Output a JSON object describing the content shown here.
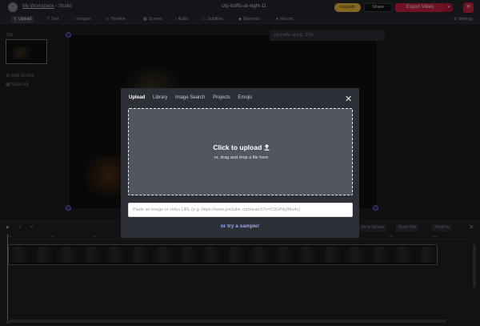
{
  "header": {
    "workspace_link": "My Workspace",
    "separator": "›",
    "current_page": "Studio",
    "project_title": "city-traffic-at-night-11",
    "upgrade_label": "Upgrade",
    "share_label": "Share",
    "export_label": "Export Video",
    "user_initial": "H"
  },
  "toolbar": {
    "items": [
      {
        "label": "Upload",
        "icon": "upload-icon",
        "glyph": "⇪",
        "active": true
      },
      {
        "label": "Text",
        "icon": "text-icon",
        "glyph": "T",
        "active": false
      },
      {
        "label": "Images",
        "icon": "images-icon",
        "glyph": "⌕",
        "active": false
      },
      {
        "label": "Timeline",
        "icon": "timeline-icon",
        "glyph": "≡",
        "active": false
      },
      {
        "label": "Scenes",
        "icon": "scenes-icon",
        "glyph": "▦",
        "active": false
      },
      {
        "label": "Audio",
        "icon": "audio-icon",
        "glyph": "♪",
        "active": false
      },
      {
        "label": "Subtitles",
        "icon": "subtitles-icon",
        "glyph": "▭",
        "active": false
      },
      {
        "label": "Elements",
        "icon": "elements-icon",
        "glyph": "◆",
        "active": false
      },
      {
        "label": "Record",
        "icon": "record-icon",
        "glyph": "●",
        "active": false
      }
    ],
    "settings_label": "Settings"
  },
  "scenes": {
    "badge": "12s",
    "add_scene": "Add Scene",
    "view_all": "View All"
  },
  "layer": {
    "name": "city-traffic-at-nig...27fd"
  },
  "timeline": {
    "ticks": [
      "0s",
      "1s",
      "2s",
      "3s",
      "4s",
      "5s",
      "6s",
      "7s",
      "8s",
      "9s",
      "10s"
    ],
    "right_buttons": [
      "Fit to Screen",
      "Zoom Out",
      "Zoom In"
    ]
  },
  "modal": {
    "tabs": [
      "Upload",
      "Library",
      "Image Search",
      "Projects",
      "Emojis"
    ],
    "active_tab": "Upload",
    "dropzone_title": "Click to upload",
    "dropzone_subtitle": "or, drag and drop a file here",
    "url_placeholder": "Paste an image or video URL (e.g. https://www.youtube.com/watch?v=C0DPdy98e4c)",
    "sample_link": "or try a sample!"
  },
  "colors": {
    "accent": "#c0223f",
    "upgrade": "#e3b33a",
    "link": "#9aa8ff"
  }
}
